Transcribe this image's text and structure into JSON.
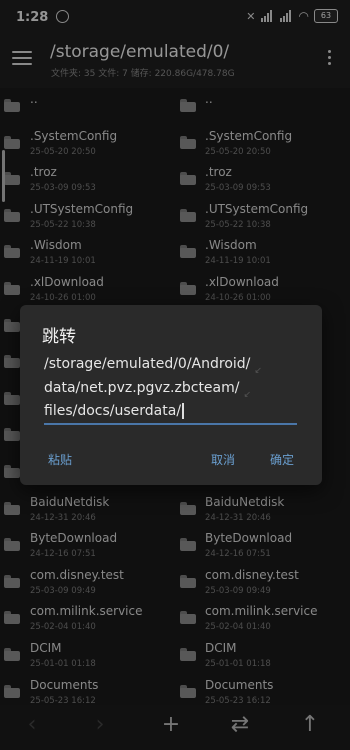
{
  "status": {
    "time": "1:28",
    "battery": "63"
  },
  "toolbar": {
    "path": "/storage/emulated/0/",
    "info": "文件夹: 35  文件: 7  储存: 220.86G/478.78G"
  },
  "files": [
    {
      "name": "..",
      "date": ""
    },
    {
      "name": ".SystemConfig",
      "date": "25-05-20 20:50"
    },
    {
      "name": ".troz",
      "date": "25-03-09 09:53"
    },
    {
      "name": ".UTSystemConfig",
      "date": "25-05-22 10:38"
    },
    {
      "name": ".Wisdom",
      "date": "24-11-19 10:01"
    },
    {
      "name": ".xlDownload",
      "date": "24-10-26 01:00"
    },
    {
      "name": "",
      "date": ""
    },
    {
      "name": "",
      "date": ""
    },
    {
      "name": "",
      "date": ""
    },
    {
      "name": "",
      "date": ""
    },
    {
      "name": "",
      "date": ""
    },
    {
      "name": "BaiduNetdisk",
      "date": "24-12-31 20:46"
    },
    {
      "name": "ByteDownload",
      "date": "24-12-16 07:51"
    },
    {
      "name": "com.disney.test",
      "date": "25-03-09 09:49"
    },
    {
      "name": "com.milink.service",
      "date": "25-02-04 01:40"
    },
    {
      "name": "DCIM",
      "date": "25-01-01 01:18"
    },
    {
      "name": "Documents",
      "date": "25-05-23 16:12"
    }
  ],
  "dialog": {
    "title": "跳转",
    "input_lines": [
      "/storage/emulated/0/Android/",
      "data/net.pvz.pgvz.zbcteam/",
      "files/docs/userdata/"
    ],
    "paste_label": "粘贴",
    "cancel_label": "取消",
    "ok_label": "确定"
  },
  "bottom": {
    "prev": "‹",
    "next": "›",
    "add": "+",
    "swap": "⇄",
    "up": "↑"
  }
}
